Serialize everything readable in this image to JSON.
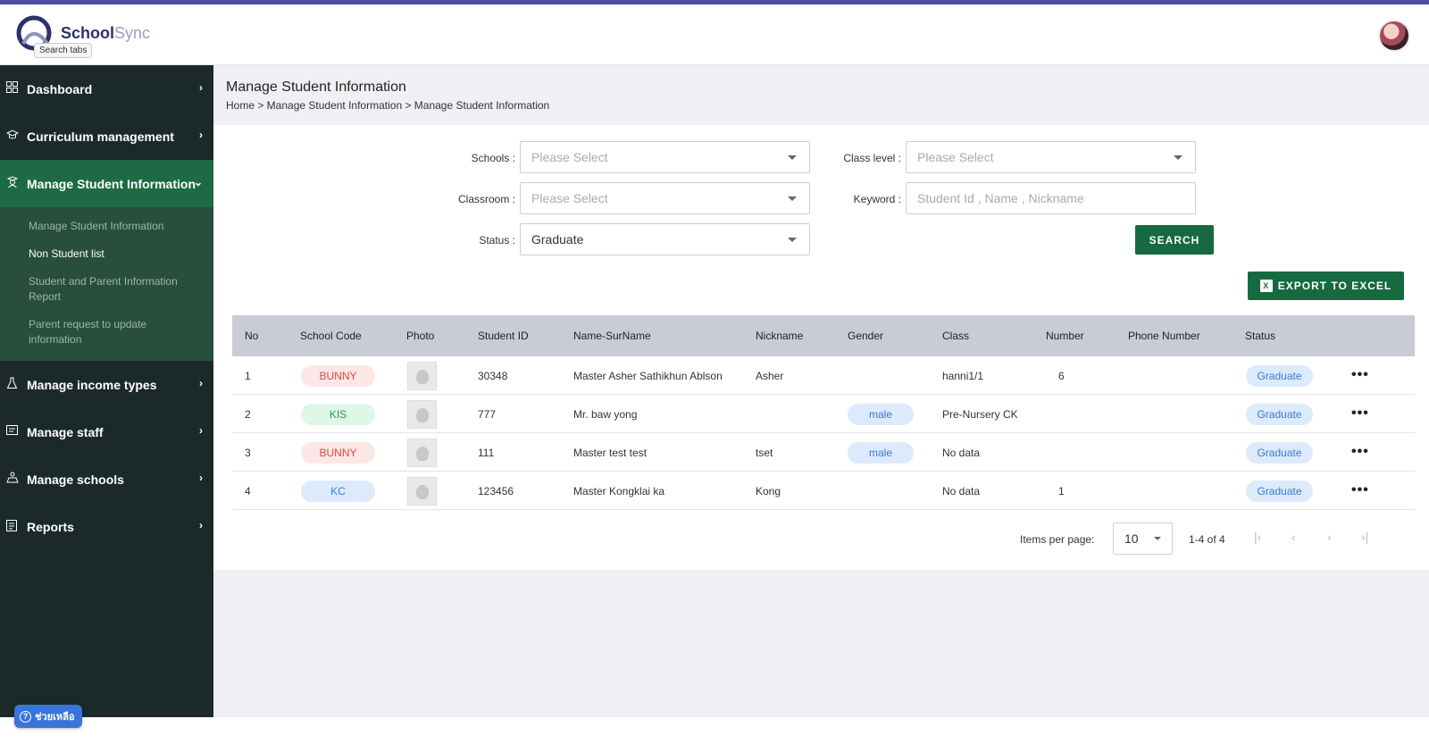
{
  "header": {
    "logo_primary": "School",
    "logo_secondary": "Sync",
    "tooltip": "Search tabs"
  },
  "sidebar": {
    "items": [
      {
        "label": "Dashboard",
        "icon": "grid-icon"
      },
      {
        "label": "Curriculum management",
        "icon": "graduation-cap-icon"
      },
      {
        "label": "Manage Student Information",
        "icon": "student-icon"
      },
      {
        "label": "Manage income types",
        "icon": "flask-icon"
      },
      {
        "label": "Manage staff",
        "icon": "id-card-icon"
      },
      {
        "label": "Manage schools",
        "icon": "school-icon"
      },
      {
        "label": "Reports",
        "icon": "clipboard-icon"
      }
    ],
    "submenu": [
      "Manage Student Information",
      "Non Student list",
      "Student and Parent Information Report",
      "Parent request to update information"
    ],
    "help_label": "ช่วยเหลือ"
  },
  "page": {
    "title": "Manage Student Information",
    "breadcrumb": "Home > Manage Student Information > Manage Student Information"
  },
  "filters": {
    "schools_label": "Schools :",
    "schools_value": "Please Select",
    "classroom_label": "Classroom :",
    "classroom_value": "Please Select",
    "status_label": "Status :",
    "status_value": "Graduate",
    "class_level_label": "Class level :",
    "class_level_value": "Please Select",
    "keyword_label": "Keyword :",
    "keyword_placeholder": "Student Id , Name , Nickname",
    "search_button": "SEARCH",
    "export_button": "EXPORT TO EXCEL"
  },
  "table": {
    "headers": [
      "No",
      "School Code",
      "Photo",
      "Student ID",
      "Name-SurName",
      "Nickname",
      "Gender",
      "Class",
      "Number",
      "Phone Number",
      "Status"
    ],
    "rows": [
      {
        "no": "1",
        "school": "BUNNY",
        "school_color": "red",
        "student_id": "30348",
        "name": "Master Asher Sathikhun Ablson",
        "nickname": "Asher",
        "gender": "",
        "class": "hanni1/1",
        "number": "6",
        "phone": "",
        "status": "Graduate"
      },
      {
        "no": "2",
        "school": "KIS",
        "school_color": "green",
        "student_id": "777",
        "name": "Mr. baw yong",
        "nickname": "",
        "gender": "male",
        "class": "Pre-Nursery CK",
        "number": "",
        "phone": "",
        "status": "Graduate"
      },
      {
        "no": "3",
        "school": "BUNNY",
        "school_color": "red",
        "student_id": "111",
        "name": "Master test test",
        "nickname": "tset",
        "gender": "male",
        "class": "No data",
        "number": "",
        "phone": "",
        "status": "Graduate"
      },
      {
        "no": "4",
        "school": "KC",
        "school_color": "blue",
        "student_id": "123456",
        "name": "Master Kongklai ka",
        "nickname": "Kong",
        "gender": "",
        "class": "No data",
        "number": "1",
        "phone": "",
        "status": "Graduate"
      }
    ]
  },
  "pagination": {
    "items_per_page_label": "Items per page:",
    "items_per_page": "10",
    "range": "1-4 of 4"
  },
  "colors": {
    "sidebar_bg": "#1b2a29",
    "sidebar_active": "#1d6a45",
    "primary_button": "#166a3f",
    "accent_bar": "#4b4f9e"
  }
}
